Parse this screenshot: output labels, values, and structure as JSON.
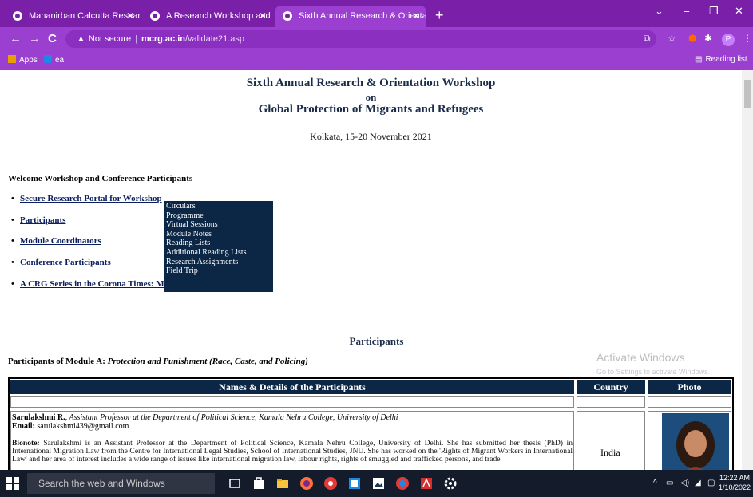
{
  "browser": {
    "tabs": [
      {
        "title": "Mahanirban Calcutta Research Gr",
        "active": false
      },
      {
        "title": "A Research Workshop and Intern",
        "active": false
      },
      {
        "title": "Sixth Annual Research & Orientat",
        "active": true
      }
    ],
    "new_tab": "+",
    "window_controls": {
      "minimize": "–",
      "maximize": "❐",
      "close": "✕"
    },
    "nav": {
      "back": "←",
      "forward": "→",
      "reload": "C"
    },
    "address": {
      "security_label": "Not secure",
      "host": "mcrg.ac.in",
      "path": "/validate21.asp"
    },
    "profile_initial": "P",
    "bookmarks": [
      {
        "label": "Apps"
      },
      {
        "label": "ea"
      }
    ],
    "reading_list": "Reading list"
  },
  "page": {
    "heading_line1": "Sixth Annual Research & Orientation Workshop",
    "heading_line2": "on",
    "heading_line3": "Global Protection of Migrants and Refugees",
    "venue": "Kolkata, 15-20 November 2021",
    "welcome": "Welcome  Workshop and Conference Participants",
    "links": [
      "Secure Research Portal for Workshop",
      "Participants",
      "Module Coordinators",
      "Conference Participants",
      "A CRG Series in the Corona Times: Migrants and Refugees"
    ],
    "dropdown": [
      "Circulars",
      "Programme",
      "Virtual Sessions",
      "Module Notes",
      "Reading Lists",
      "Additional Reading Lists",
      "Research Assignments",
      "Field Trip"
    ],
    "section_title": "Participants",
    "module_prefix": "Participants of Module A: ",
    "module_name": "Protection and Punishment (Race, Caste, and Policing)",
    "table": {
      "headers": [
        "Names & Details of the Participants",
        "Country",
        "Photo"
      ],
      "row": {
        "name": "Sarulakshmi R.",
        "title": ", Assistant Professor at the Department of Political Science, Kamala Nehru College, University of Delhi",
        "email_label": "Email:",
        "email": "sarulakshmi439@gmail.com",
        "bio_label": "Bionote:",
        "bio": "Sarulakshmi is an Assistant Professor at the Department of Political Science, Kamala Nehru College, University of Delhi. She has submitted her thesis (PhD) in International Migration Law from the Centre for International Legal Studies, School of International Studies, JNU. She has worked on the 'Rights of Migrant Workers in International Law' and her area of interest includes a wide range of issues like international migration law, labour rights, rights of smuggled and trafficked persons, and trade",
        "country": "India"
      }
    }
  },
  "watermark": {
    "line1": "Activate Windows",
    "line2": "Go to Settings to activate Windows."
  },
  "taskbar": {
    "search_placeholder": "Search the web and Windows",
    "time": "12:22 AM",
    "date": "1/10/2022"
  },
  "colors": {
    "tab_bg": "#7a1fa8",
    "toolbar_bg": "#9b3fd0",
    "page_navy": "#0c2646",
    "taskbar": "#141c2b"
  }
}
